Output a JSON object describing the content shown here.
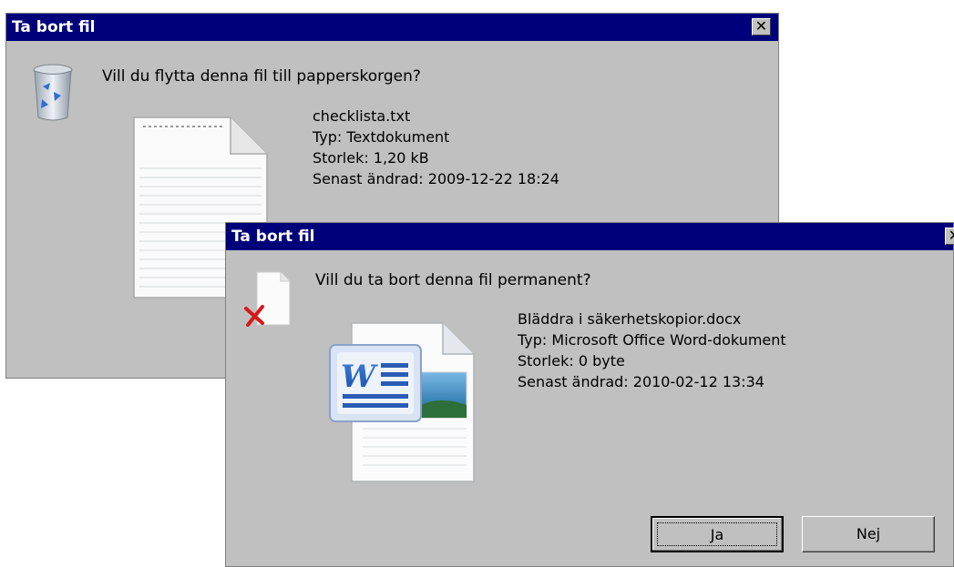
{
  "dialog1": {
    "title": "Ta bort fil",
    "close_glyph": "✕",
    "prompt": "Vill du flytta denna fil till papperskorgen?",
    "icon": "recycle-bin-icon",
    "file_icon": "text-document-icon",
    "file_name": "checklista.txt",
    "file_type": "Typ: Textdokument",
    "file_size": "Storlek: 1,20 kB",
    "file_modified": "Senast ändrad: 2009-12-22 18:24"
  },
  "dialog2": {
    "title": "Ta bort fil",
    "close_glyph": "✕",
    "prompt": "Vill du ta bort denna fil permanent?",
    "icon": "delete-file-icon",
    "file_icon": "word-document-icon",
    "file_name": "Bläddra i säkerhetskopior.docx",
    "file_type": "Typ: Microsoft Office Word-dokument",
    "file_size": "Storlek: 0 byte",
    "file_modified": "Senast ändrad: 2010-02-12 13:34",
    "yes_label": "Ja",
    "no_label": "Nej"
  }
}
